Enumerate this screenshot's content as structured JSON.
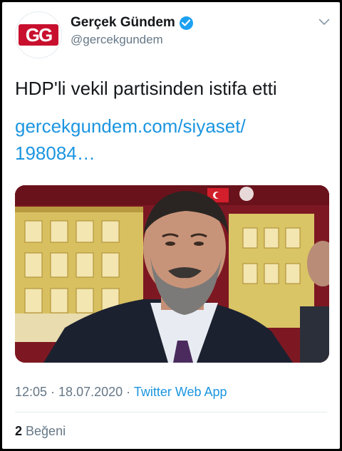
{
  "account": {
    "display_name": "Gerçek Gündem",
    "handle": "@gercekgundem",
    "logo_text": "GG",
    "verified": true
  },
  "tweet": {
    "text": "HDP'li vekil partisinden istifa etti",
    "link": "gercekgundem.com/siyaset/198084…",
    "link_line1": "gercekgundem.com/siyaset/",
    "link_line2": "198084…"
  },
  "meta": {
    "time": "12:05",
    "separator": " · ",
    "date": "18.07.2020",
    "source": "Twitter Web App"
  },
  "stats": {
    "likes_count": "2",
    "likes_label": "Beğeni"
  },
  "colors": {
    "accent": "#1da1f2",
    "link": "#1b95e0",
    "secondary_text": "#657786",
    "logo_red": "#c8102e"
  },
  "icons": {
    "verified": "verified-badge-icon",
    "more": "chevron-down-icon"
  }
}
